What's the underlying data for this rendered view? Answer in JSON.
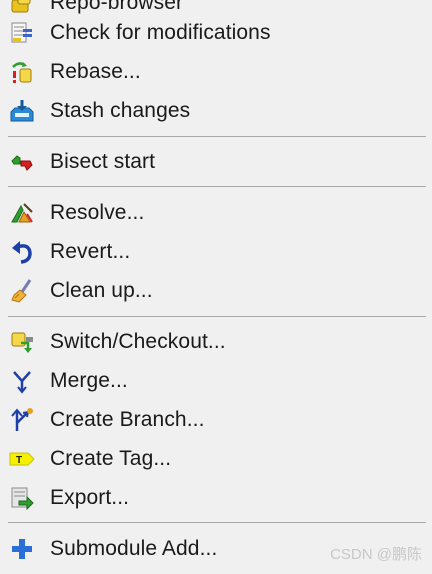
{
  "menu": {
    "items": [
      {
        "id": "repo-browser",
        "label": "Repo-browser",
        "icon": "repo-browser-icon"
      },
      {
        "id": "check-modifications",
        "label": "Check for modifications",
        "icon": "check-modifications-icon"
      },
      {
        "id": "rebase",
        "label": "Rebase...",
        "icon": "rebase-icon"
      },
      {
        "id": "stash",
        "label": "Stash changes",
        "icon": "stash-icon"
      },
      {
        "id": "bisect",
        "label": "Bisect start",
        "icon": "bisect-icon"
      },
      {
        "id": "resolve",
        "label": "Resolve...",
        "icon": "resolve-icon"
      },
      {
        "id": "revert",
        "label": "Revert...",
        "icon": "revert-icon"
      },
      {
        "id": "cleanup",
        "label": "Clean up...",
        "icon": "broom-icon"
      },
      {
        "id": "switch",
        "label": "Switch/Checkout...",
        "icon": "switch-icon"
      },
      {
        "id": "merge",
        "label": "Merge...",
        "icon": "merge-icon"
      },
      {
        "id": "create-branch",
        "label": "Create Branch...",
        "icon": "branch-icon"
      },
      {
        "id": "create-tag",
        "label": "Create Tag...",
        "icon": "tag-icon"
      },
      {
        "id": "export",
        "label": "Export...",
        "icon": "export-icon"
      },
      {
        "id": "submodule-add",
        "label": "Submodule Add...",
        "icon": "plus-icon"
      }
    ]
  },
  "watermark": "CSDN @鹏陈"
}
